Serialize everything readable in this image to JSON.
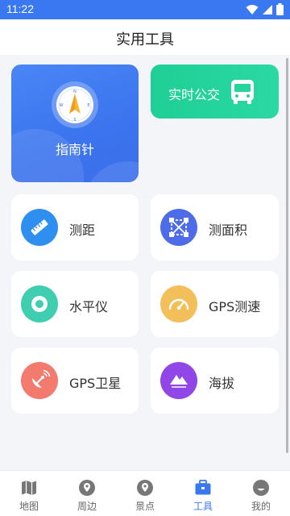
{
  "status_bar": {
    "time": "11:22",
    "icons": [
      "wifi-icon",
      "signal-icon",
      "battery-icon"
    ]
  },
  "app_bar": {
    "title": "实用工具"
  },
  "featured": {
    "compass": {
      "label": "指南针",
      "icon": "compass-icon"
    },
    "bus": {
      "label": "实时公交",
      "icon": "bus-icon"
    }
  },
  "tools": [
    {
      "label": "测距",
      "icon": "ruler-icon",
      "color": "#2f8ff0"
    },
    {
      "label": "测面积",
      "icon": "area-icon",
      "color": "#4f6ce8"
    },
    {
      "label": "水平仪",
      "icon": "level-icon",
      "color": "#3fcfb0"
    },
    {
      "label": "GPS测速",
      "icon": "speedometer-icon",
      "color": "#f2bf5a"
    },
    {
      "label": "GPS卫星",
      "icon": "satellite-icon",
      "color": "#f27a6e"
    },
    {
      "label": "海拔",
      "icon": "mountain-icon",
      "color": "#9146e8"
    }
  ],
  "tab_bar": {
    "active": "工具",
    "tabs": [
      {
        "label": "地图",
        "icon": "map-icon"
      },
      {
        "label": "周边",
        "icon": "location-pin-icon"
      },
      {
        "label": "景点",
        "icon": "location-pin-icon"
      },
      {
        "label": "工具",
        "icon": "toolbox-icon"
      },
      {
        "label": "我的",
        "icon": "smiley-icon"
      }
    ]
  },
  "colors": {
    "primary": "#3a78f2",
    "bus_green": "#22d39a",
    "background": "#f4f5f8"
  }
}
